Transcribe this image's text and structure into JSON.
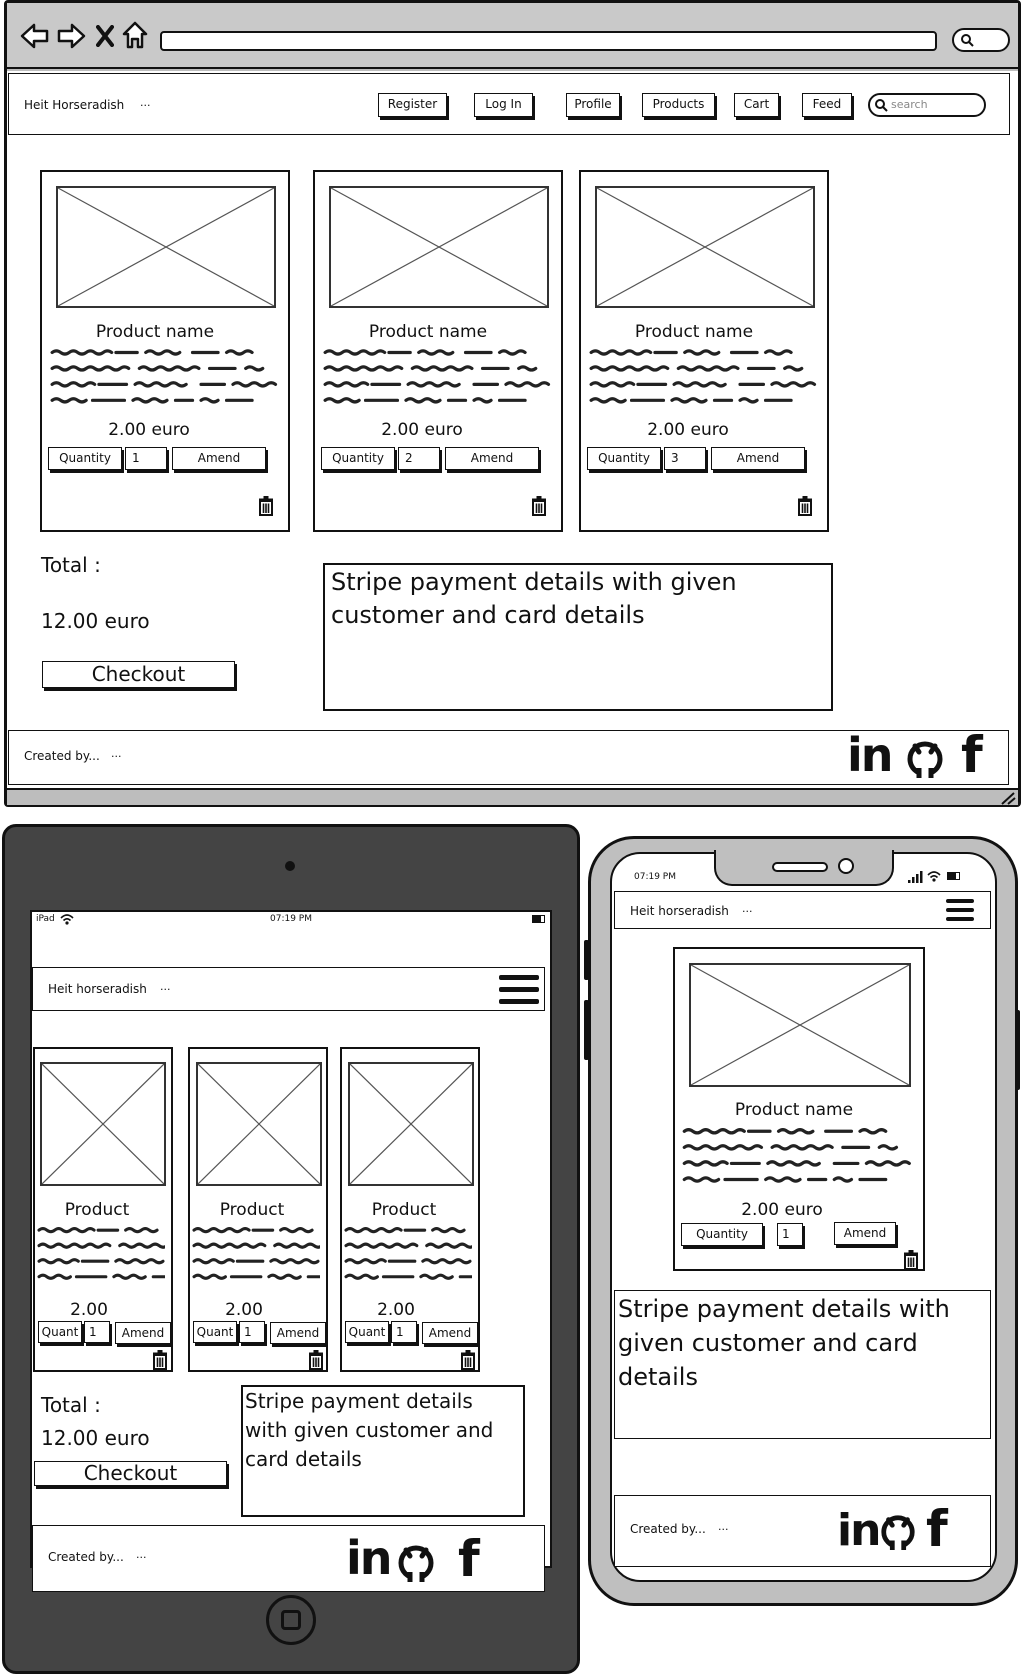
{
  "desktop": {
    "nav": {
      "brand": "Heit Horseradish",
      "brand_dots": "...",
      "links": [
        "Register",
        "Log In",
        "Profile",
        "Products",
        "Cart",
        "Feed"
      ],
      "search_placeholder": "search"
    },
    "products": [
      {
        "name": "Product name",
        "price": "2.00 euro",
        "qty_label": "Quantity",
        "qty": "1",
        "amend": "Amend"
      },
      {
        "name": "Product name",
        "price": "2.00 euro",
        "qty_label": "Quantity",
        "qty": "2",
        "amend": "Amend"
      },
      {
        "name": "Product name",
        "price": "2.00 euro",
        "qty_label": "Quantity",
        "qty": "3",
        "amend": "Amend"
      }
    ],
    "total_label": "Total :",
    "total_value": "12.00 euro",
    "checkout": "Checkout",
    "stripe_line1": "Stripe payment details with given",
    "stripe_line2": "customer and card details",
    "footer": {
      "created": "Created by...",
      "dots": "..."
    }
  },
  "tablet": {
    "status_left": "iPad",
    "status_time": "07:19 PM",
    "brand": "Heit horseradish",
    "brand_dots": "...",
    "products": [
      {
        "name": "Product",
        "price": "2.00",
        "qty_label": "Quant",
        "qty": "1",
        "amend": "Amend"
      },
      {
        "name": "Product",
        "price": "2.00",
        "qty_label": "Quant",
        "qty": "1",
        "amend": "Amend"
      },
      {
        "name": "Product",
        "price": "2.00",
        "qty_label": "Quant",
        "qty": "1",
        "amend": "Amend"
      }
    ],
    "total_label": "Total :",
    "total_value": "12.00 euro",
    "checkout": "Checkout",
    "stripe_line1": "Stripe payment details",
    "stripe_line2": "with given customer and",
    "stripe_line3": "card details",
    "footer": {
      "created": "Created by...",
      "dots": "..."
    }
  },
  "phone": {
    "status_time": "07:19 PM",
    "brand": "Heit horseradish",
    "brand_dots": "...",
    "product": {
      "name": "Product name",
      "price": "2.00 euro",
      "qty_label": "Quantity",
      "qty": "1",
      "amend": "Amend"
    },
    "stripe_line1": "Stripe payment details with",
    "stripe_line2": "given customer and card",
    "stripe_line3": "details",
    "footer": {
      "created": "Created by...",
      "dots": "..."
    }
  }
}
